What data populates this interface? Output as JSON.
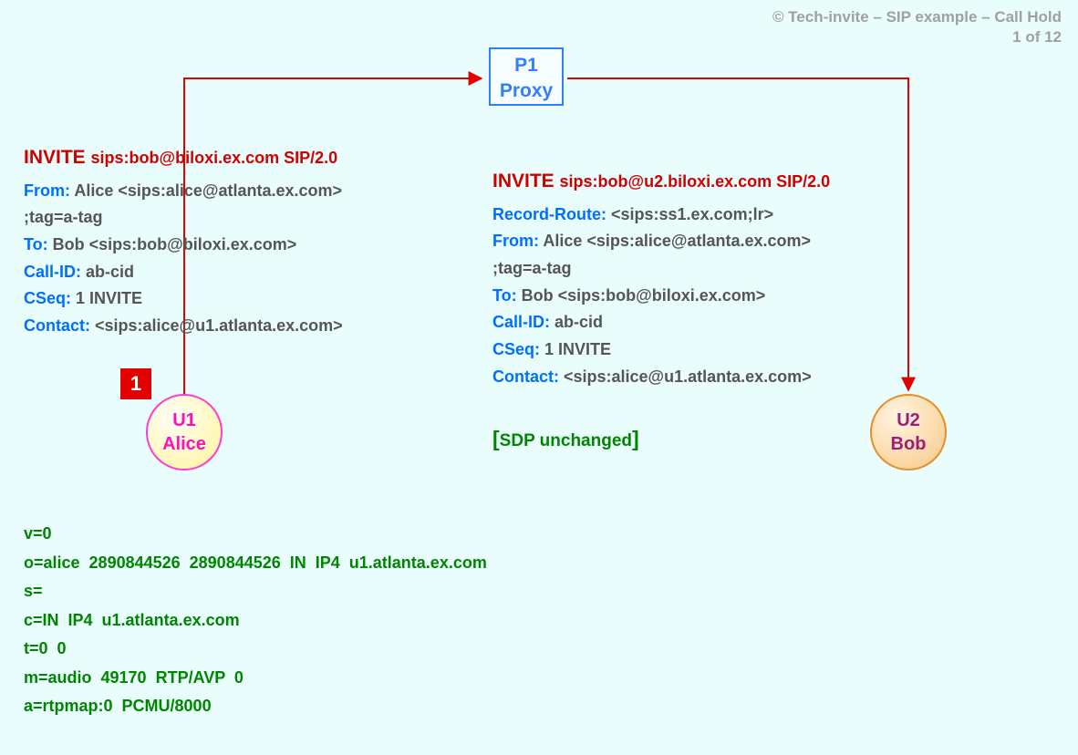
{
  "meta": {
    "copyright": "© Tech-invite – SIP example – Call Hold",
    "page": "1 of 12"
  },
  "proxy": {
    "line1": "P1",
    "line2": "Proxy"
  },
  "step_badge": "1",
  "alice": {
    "line1": "U1",
    "line2": "Alice"
  },
  "bob": {
    "line1": "U2",
    "line2": "Bob"
  },
  "msg_left": {
    "method": "INVITE",
    "request_uri": "sips:bob@biloxi.ex.com SIP/2.0",
    "headers": [
      {
        "name": "From",
        "value": "Alice <sips:alice@atlanta.ex.com>"
      },
      {
        "name": "",
        "value": " ;tag=a-tag"
      },
      {
        "name": "To",
        "value": "Bob <sips:bob@biloxi.ex.com>"
      },
      {
        "name": "Call-ID",
        "value": "ab-cid"
      },
      {
        "name": "CSeq",
        "value": "1 INVITE"
      },
      {
        "name": "Contact",
        "value": "<sips:alice@u1.atlanta.ex.com>"
      }
    ]
  },
  "msg_right": {
    "method": "INVITE",
    "request_uri": "sips:bob@u2.biloxi.ex.com SIP/2.0",
    "headers": [
      {
        "name": "Record-Route",
        "value": "<sips:ss1.ex.com;lr>"
      },
      {
        "name": "From",
        "value": "Alice <sips:alice@atlanta.ex.com>"
      },
      {
        "name": "",
        "value": " ;tag=a-tag"
      },
      {
        "name": "To",
        "value": "Bob <sips:bob@biloxi.ex.com>"
      },
      {
        "name": "Call-ID",
        "value": "ab-cid"
      },
      {
        "name": "CSeq",
        "value": "1 INVITE"
      },
      {
        "name": "Contact",
        "value": "<sips:alice@u1.atlanta.ex.com>"
      }
    ]
  },
  "sdp_unchanged": "SDP unchanged",
  "sdp": [
    "v=0",
    "o=alice  2890844526  2890844526  IN  IP4  u1.atlanta.ex.com",
    "s=",
    "c=IN  IP4  u1.atlanta.ex.com",
    "t=0  0",
    "m=audio  49170  RTP/AVP  0",
    "a=rtpmap:0  PCMU/8000"
  ]
}
